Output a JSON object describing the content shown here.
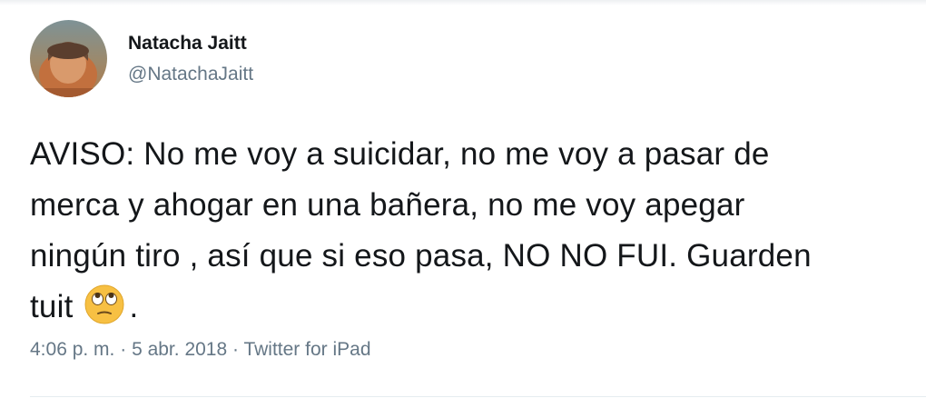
{
  "user": {
    "display_name": "Natacha Jaitt",
    "handle": "@NatachaJaitt"
  },
  "tweet": {
    "lines": [
      "AVISO: No me voy a suicidar, no me voy a pasar de",
      "merca y ahogar en una bañera, no me voy apegar",
      "ningún tiro , así que si eso pasa, NO NO FUI. Guarden"
    ],
    "last_line_before_emoji": "tuit",
    "last_line_after_emoji": ".",
    "emoji": "face-with-rolling-eyes-icon"
  },
  "meta": {
    "time": "4:06 p. m.",
    "separator": " · ",
    "date": "5 abr. 2018",
    "source": "Twitter for iPad"
  },
  "colors": {
    "text_primary": "#14171a",
    "text_secondary": "#657786",
    "divider": "#e6ecf0",
    "emoji_face": "#f7c043"
  }
}
